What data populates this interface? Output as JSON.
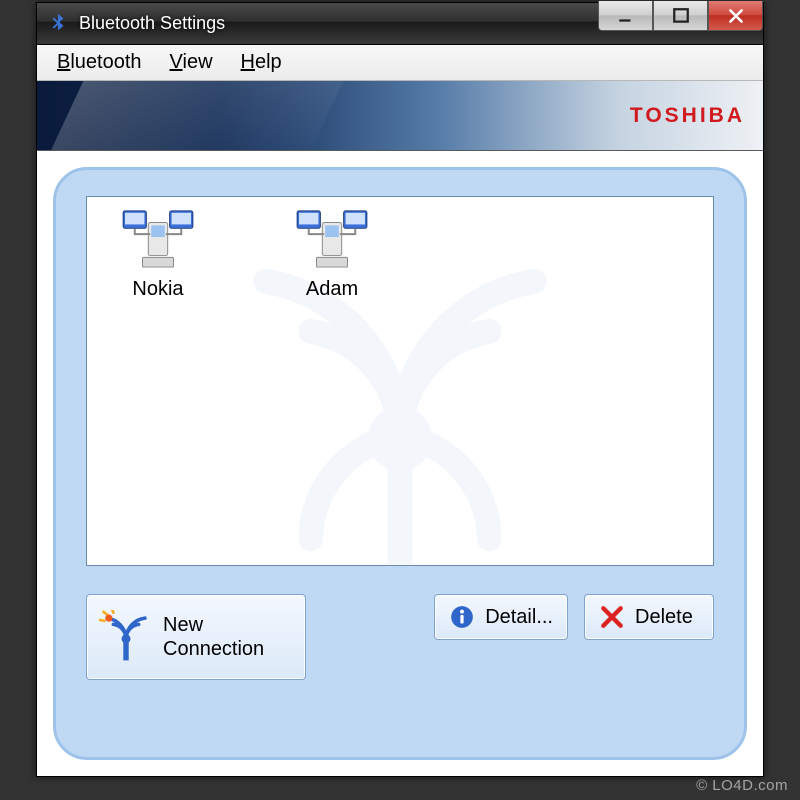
{
  "window": {
    "title": "Bluetooth Settings"
  },
  "menu": {
    "bluetooth": "Bluetooth",
    "view": "View",
    "help": "Help"
  },
  "brand": "TOSHIBA",
  "devices": [
    {
      "name": "Nokia"
    },
    {
      "name": "Adam"
    }
  ],
  "buttons": {
    "new_connection": "New\nConnection",
    "detail": "Detail...",
    "delete": "Delete"
  },
  "site_watermark": "© LO4D.com"
}
